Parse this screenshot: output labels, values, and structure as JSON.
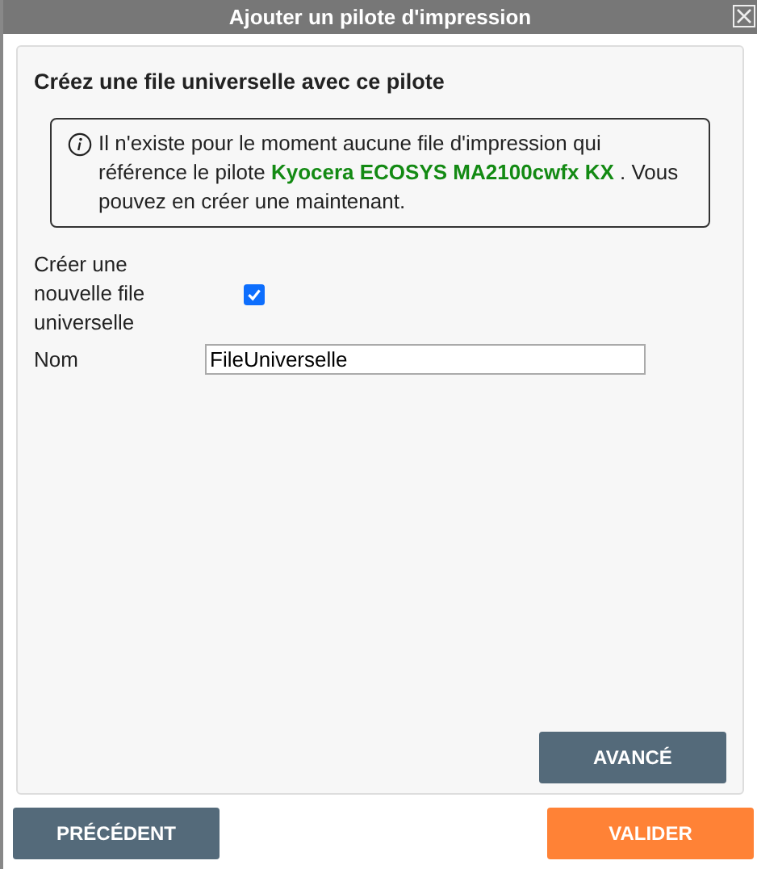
{
  "window": {
    "title": "Ajouter un pilote d'impression"
  },
  "panel": {
    "heading": "Créez une file universelle avec ce pilote",
    "info": "Il n'existe pour le moment aucune file d'impression qui référence le pilote **Kyocera ECOSYS MA2100cwfx KX** . Vous pouvez en créer une maintenant.",
    "fields": [
      {
        "kind": "checkbox",
        "label": "Créer une nouvelle file universelle",
        "checked": true
      },
      {
        "kind": "text",
        "label": "Nom",
        "value": "FileUniverselle"
      }
    ],
    "advanced_button": "AVANCÉ"
  },
  "buttons": [
    {
      "label": "PRÉCÉDENT",
      "kind": "secondary"
    },
    {
      "label": "VALIDER",
      "kind": "primary"
    }
  ]
}
